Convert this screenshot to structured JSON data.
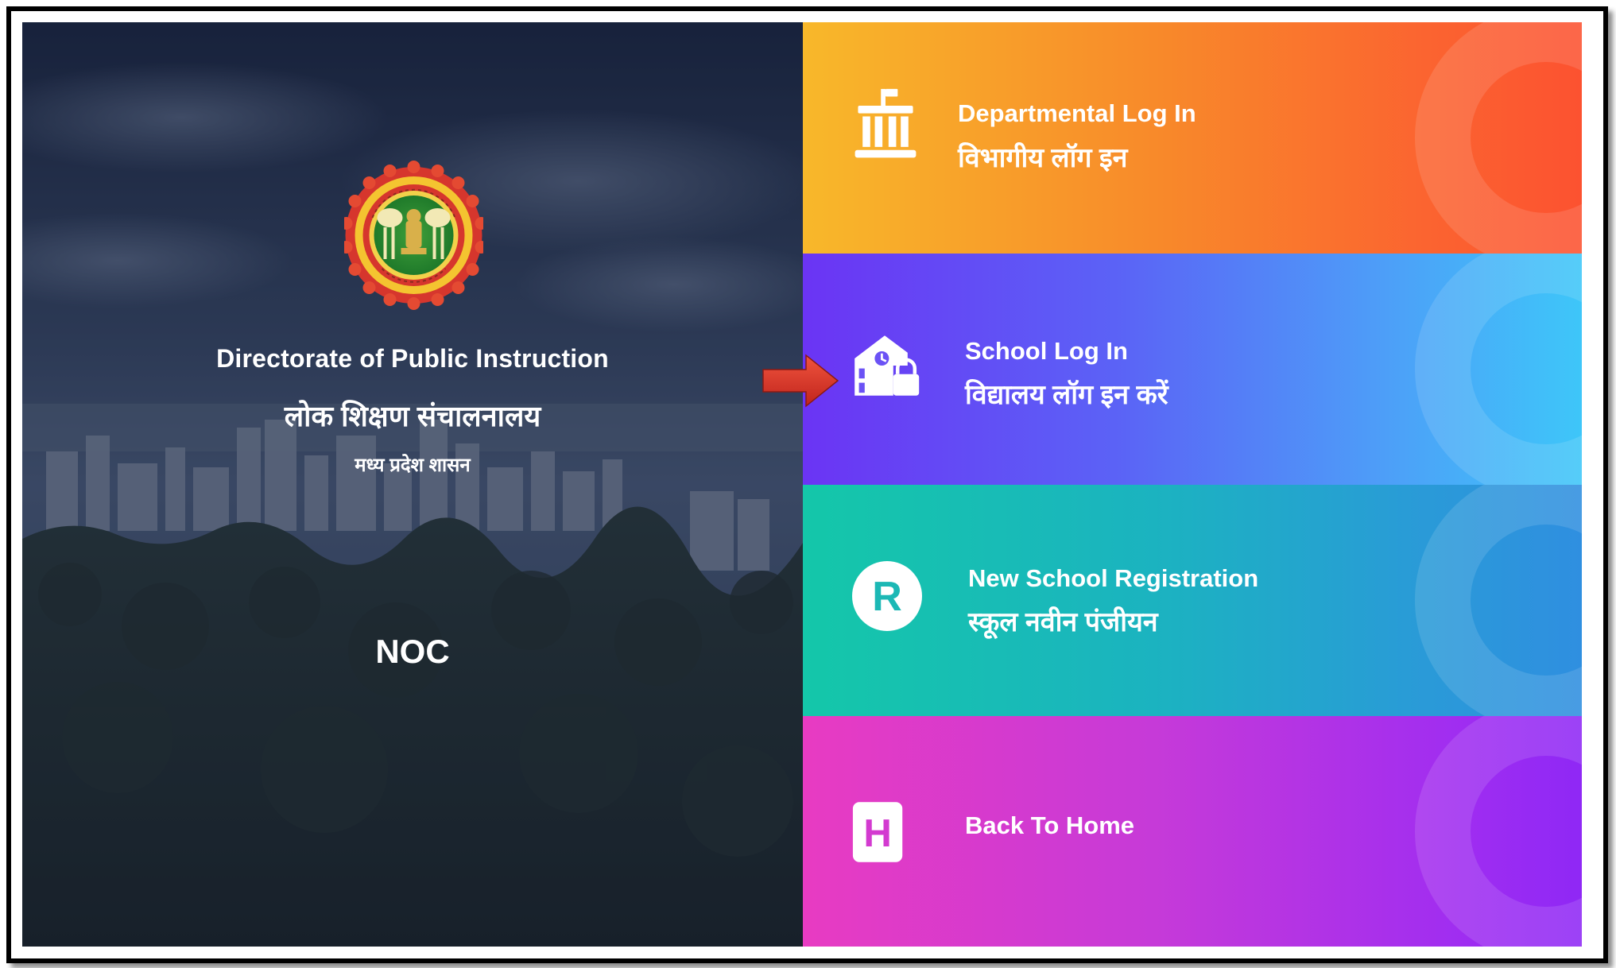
{
  "left_panel": {
    "title_en": "Directorate of Public Instruction",
    "title_hi": "लोक शिक्षण संचालनालय",
    "subtitle_hi": "मध्य प्रदेश शासन",
    "app_name": "NOC",
    "emblem_icon": "mp-government-emblem-icon"
  },
  "tiles": [
    {
      "id": "departmental-login",
      "label_en": "Departmental Log In",
      "label_hi": "विभागीय लॉग इन",
      "icon": "building-columns-icon"
    },
    {
      "id": "school-login",
      "label_en": "School Log In",
      "label_hi": "विद्यालय लॉग इन करें",
      "icon": "school-lock-icon"
    },
    {
      "id": "new-school-registration",
      "label_en": "New School Registration",
      "label_hi": "स्कूल नवीन पंजीयन",
      "icon": "registration-r-icon"
    },
    {
      "id": "back-to-home",
      "label_en": "Back To Home",
      "icon": "home-h-icon"
    }
  ],
  "annotation": {
    "arrow_icon": "red-arrow-right-icon",
    "arrow_color": "#e0342a"
  }
}
